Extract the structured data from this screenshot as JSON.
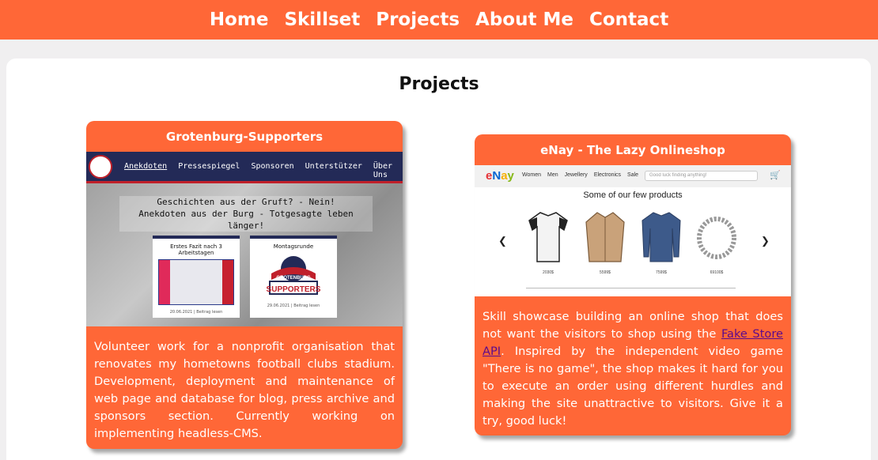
{
  "nav": {
    "items": [
      "Home",
      "Skillset",
      "Projects",
      "About Me",
      "Contact"
    ]
  },
  "section": {
    "title": "Projects"
  },
  "colors": {
    "accent": "#ff6737",
    "link": "#5b0a8c"
  },
  "projects": [
    {
      "title": "Grotenburg-Supporters",
      "description": "Volunteer work for a nonprofit organisation that renovates my hometowns football clubs stadium. Development, deployment and maintenance of web page and database for blog, press archive and sponsors section. Currently working on implementing headless-CMS.",
      "screenshot": {
        "nav_links": [
          "Anekdoten",
          "Pressespiegel",
          "Sponsoren",
          "Unterstützer",
          "Über Uns"
        ],
        "headline_1": "Geschichten aus der Gruft? - Nein!",
        "headline_2": "Anekdoten aus der Burg - Totgesagte leben länger!",
        "post_1_title": "Erstes Fazit nach 3 Arbeitstagen",
        "post_1_meta": "20.06.2021 | Beitrag lesen",
        "post_2_title": "Montagsrunde",
        "post_2_meta": "29.06.2021 | Beitrag lesen",
        "badge_line_1": "GROTENBURG",
        "badge_line_2": "SUPPORTERS"
      }
    },
    {
      "title": "eNay - The Lazy Onlineshop",
      "description_before_link": "Skill showcase building an online shop that does not want the visitors to shop using the ",
      "link_text": "Fake Store API",
      "description_after_link": ". Inspired by the independent video game \"There is no game\", the shop makes it hard for you to execute an order using different hurdles and making the site unattractive to visitors. Give it a try, good luck!",
      "screenshot": {
        "logo": "eNay",
        "menu": [
          "Women",
          "Men",
          "Jewellery",
          "Electronics",
          "Sale"
        ],
        "search_placeholder": "Good luck finding anything!",
        "heading": "Some of our few products",
        "prices": [
          "2030$",
          "5599$",
          "7599$",
          "69100$"
        ]
      }
    }
  ]
}
